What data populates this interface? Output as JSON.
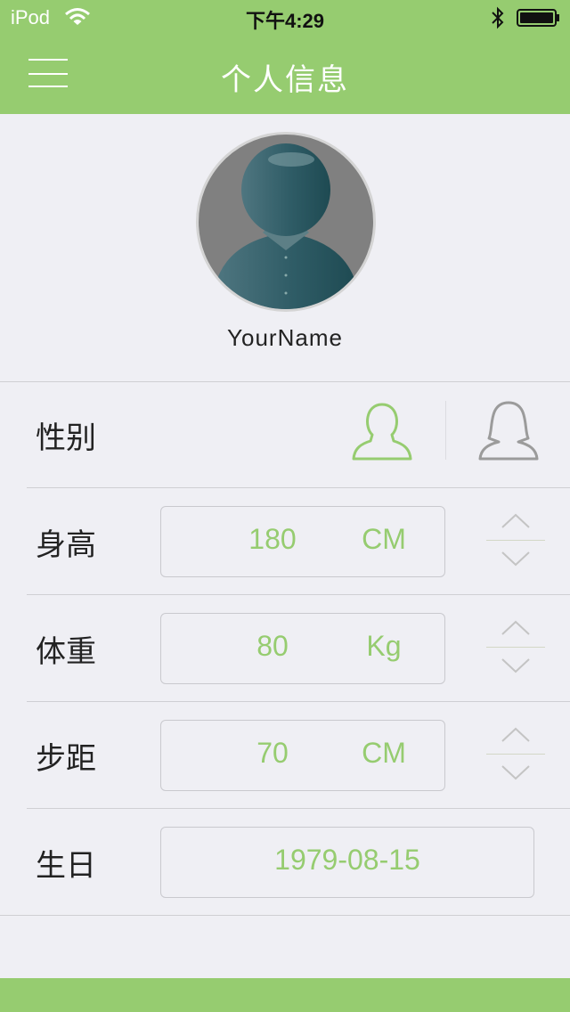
{
  "status_bar": {
    "device": "iPod",
    "time": "下午4:29"
  },
  "header": {
    "title": "个人信息"
  },
  "profile": {
    "name": "YourName"
  },
  "fields": {
    "gender": {
      "label": "性别",
      "selected": "male"
    },
    "height": {
      "label": "身高",
      "value": "180",
      "unit": "CM"
    },
    "weight": {
      "label": "体重",
      "value": "80",
      "unit": "Kg"
    },
    "stride": {
      "label": "步距",
      "value": "70",
      "unit": "CM"
    },
    "birthday": {
      "label": "生日",
      "value": "1979-08-15"
    }
  },
  "colors": {
    "accent": "#96cc70",
    "background": "#efeff4",
    "inactive": "#9b9b9b"
  },
  "icons": [
    "menu-icon",
    "wifi-icon",
    "bluetooth-icon",
    "battery-icon",
    "male-icon",
    "female-icon",
    "chevron-up-icon",
    "chevron-down-icon",
    "avatar-icon"
  ]
}
